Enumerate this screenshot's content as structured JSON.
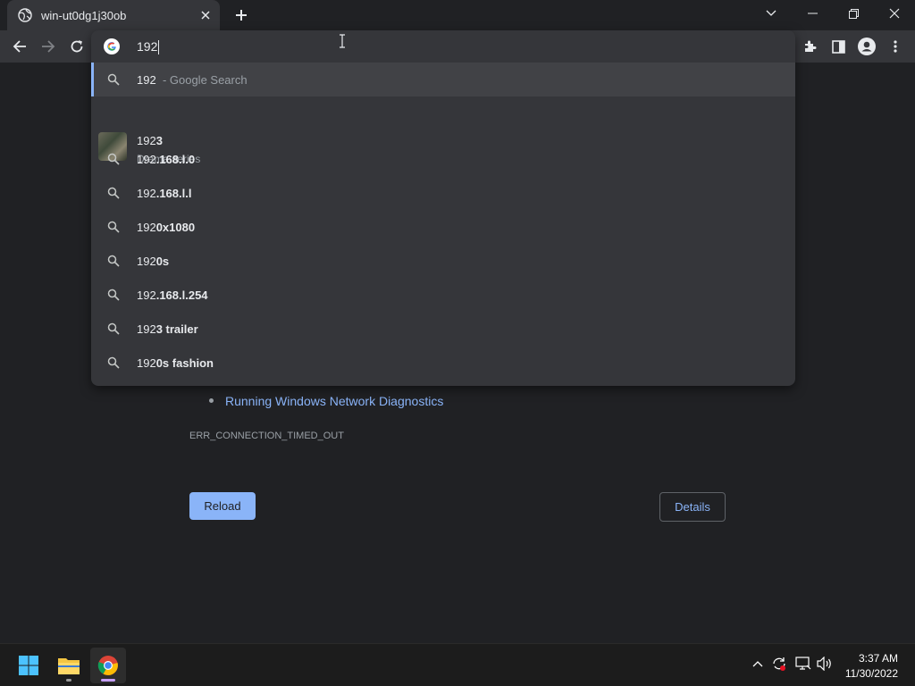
{
  "browser": {
    "tab_title": "win-ut0dg1j30ob",
    "omnibox_text": "192"
  },
  "suggestions": [
    {
      "prefix": "192",
      "rest": "",
      "suffix": "- Google Search"
    },
    {
      "prefix": "192",
      "rest": ".168.l.0",
      "suffix": ""
    },
    {
      "prefix": "192",
      "rest": ".168.l.l",
      "suffix": ""
    },
    {
      "prefix": "192",
      "rest": "0x1080",
      "suffix": ""
    },
    {
      "prefix": "192",
      "rest": "0s",
      "suffix": ""
    },
    {
      "prefix": "192",
      "rest": ".168.l.254",
      "suffix": ""
    },
    {
      "prefix": "192",
      "rest": "3 trailer",
      "suffix": ""
    },
    {
      "prefix": "192",
      "rest": "0s fashion",
      "suffix": ""
    }
  ],
  "entity_suggestion": {
    "prefix": "192",
    "rest": "3",
    "subtitle": "Drama series"
  },
  "page": {
    "link_text": "Running Windows Network Diagnostics",
    "error_code": "ERR_CONNECTION_TIMED_OUT",
    "reload_label": "Reload",
    "details_label": "Details"
  },
  "taskbar": {
    "time": "3:37 AM",
    "date": "11/30/2022"
  },
  "colors": {
    "accent": "#8ab4f8",
    "background": "#202124",
    "toolbar": "#35363a"
  }
}
